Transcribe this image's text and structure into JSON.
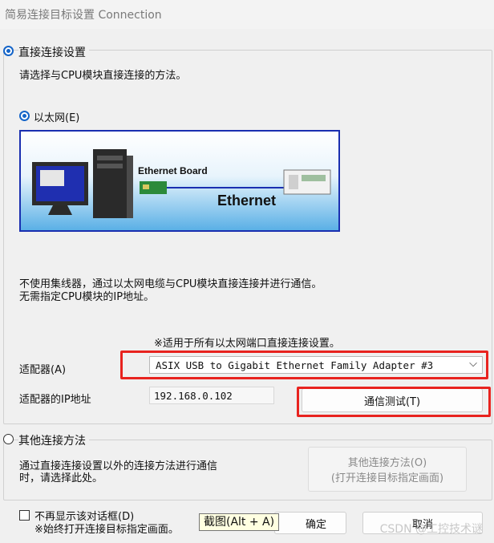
{
  "window": {
    "title": "简易连接目标设置 Connection"
  },
  "direct": {
    "label": "直接连接设置",
    "description": "请选择与CPU模块直接连接的方法。",
    "ethernet_option": "以太网(E)",
    "image": {
      "board_label": "Ethernet Board",
      "network_label": "Ethernet"
    },
    "note_line1": "不使用集线器，通过以太网电缆与CPU模块直接连接并进行通信。",
    "note_line2": "无需指定CPU模块的IP地址。",
    "applies_note": "※适用于所有以太网端口直接连接设置。",
    "adapter_label": "适配器(A)",
    "adapter_value": "ASIX USB to Gigabit Ethernet Family Adapter #3",
    "ip_label": "适配器的IP地址",
    "ip_value": "192.168.0.102",
    "test_button": "通信测试(T)"
  },
  "other": {
    "label": "其他连接方法",
    "desc_line1": "通过直接连接设置以外的连接方法进行通信",
    "desc_line2": "时，请选择此处。",
    "button_line1": "其他连接方法(O)",
    "button_line2": "(打开连接目标指定画面)"
  },
  "footer": {
    "dont_show_label": "不再显示该对话框(D)",
    "dont_show_note": "※始终打开连接目标指定画面。",
    "ok_partial": "确定",
    "cancel": "取消"
  },
  "tooltip": "截图(Alt + A)",
  "watermark": "CSDN @工控技术谜",
  "colors": {
    "accent": "#1464c8",
    "highlight": "#e8231f",
    "illus_border": "#1a2fb0"
  }
}
